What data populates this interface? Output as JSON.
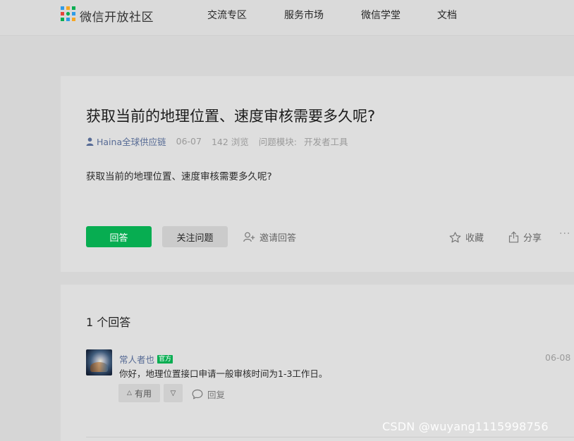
{
  "header": {
    "brand": "微信开放社区",
    "nav": [
      "交流专区",
      "服务市场",
      "微信学堂",
      "文档"
    ]
  },
  "question": {
    "title": "获取当前的地理位置、速度审核需要多久呢?",
    "author": "Haina全球供应链",
    "date": "06-07",
    "views": "142 浏览",
    "module_label": "问题模块:",
    "module": "开发者工具",
    "body": "获取当前的地理位置、速度审核需要多久呢?",
    "actions": {
      "answer": "回答",
      "follow": "关注问题",
      "invite": "邀请回答",
      "collect": "收藏",
      "share": "分享",
      "more": "···"
    }
  },
  "answers": {
    "count_label": "1 个回答",
    "items": [
      {
        "user": "常人者也",
        "badge": "官方",
        "date": "06-08",
        "text": "你好，地理位置接口申请一般审核时间为1-3工作日。",
        "useful": "有用",
        "reply": "回复"
      }
    ]
  },
  "watermark": "CSDN @wuyang1115998756",
  "colors": {
    "accent_green": "#07ad51",
    "link_blue": "#576b95",
    "page_bg": "#d6d6d6",
    "card_bg": "#dedede"
  },
  "icons": [
    "community-logo-icon",
    "user-icon",
    "add-user-icon",
    "star-icon",
    "share-icon",
    "comment-icon",
    "triangle-up-icon",
    "triangle-down-icon"
  ]
}
